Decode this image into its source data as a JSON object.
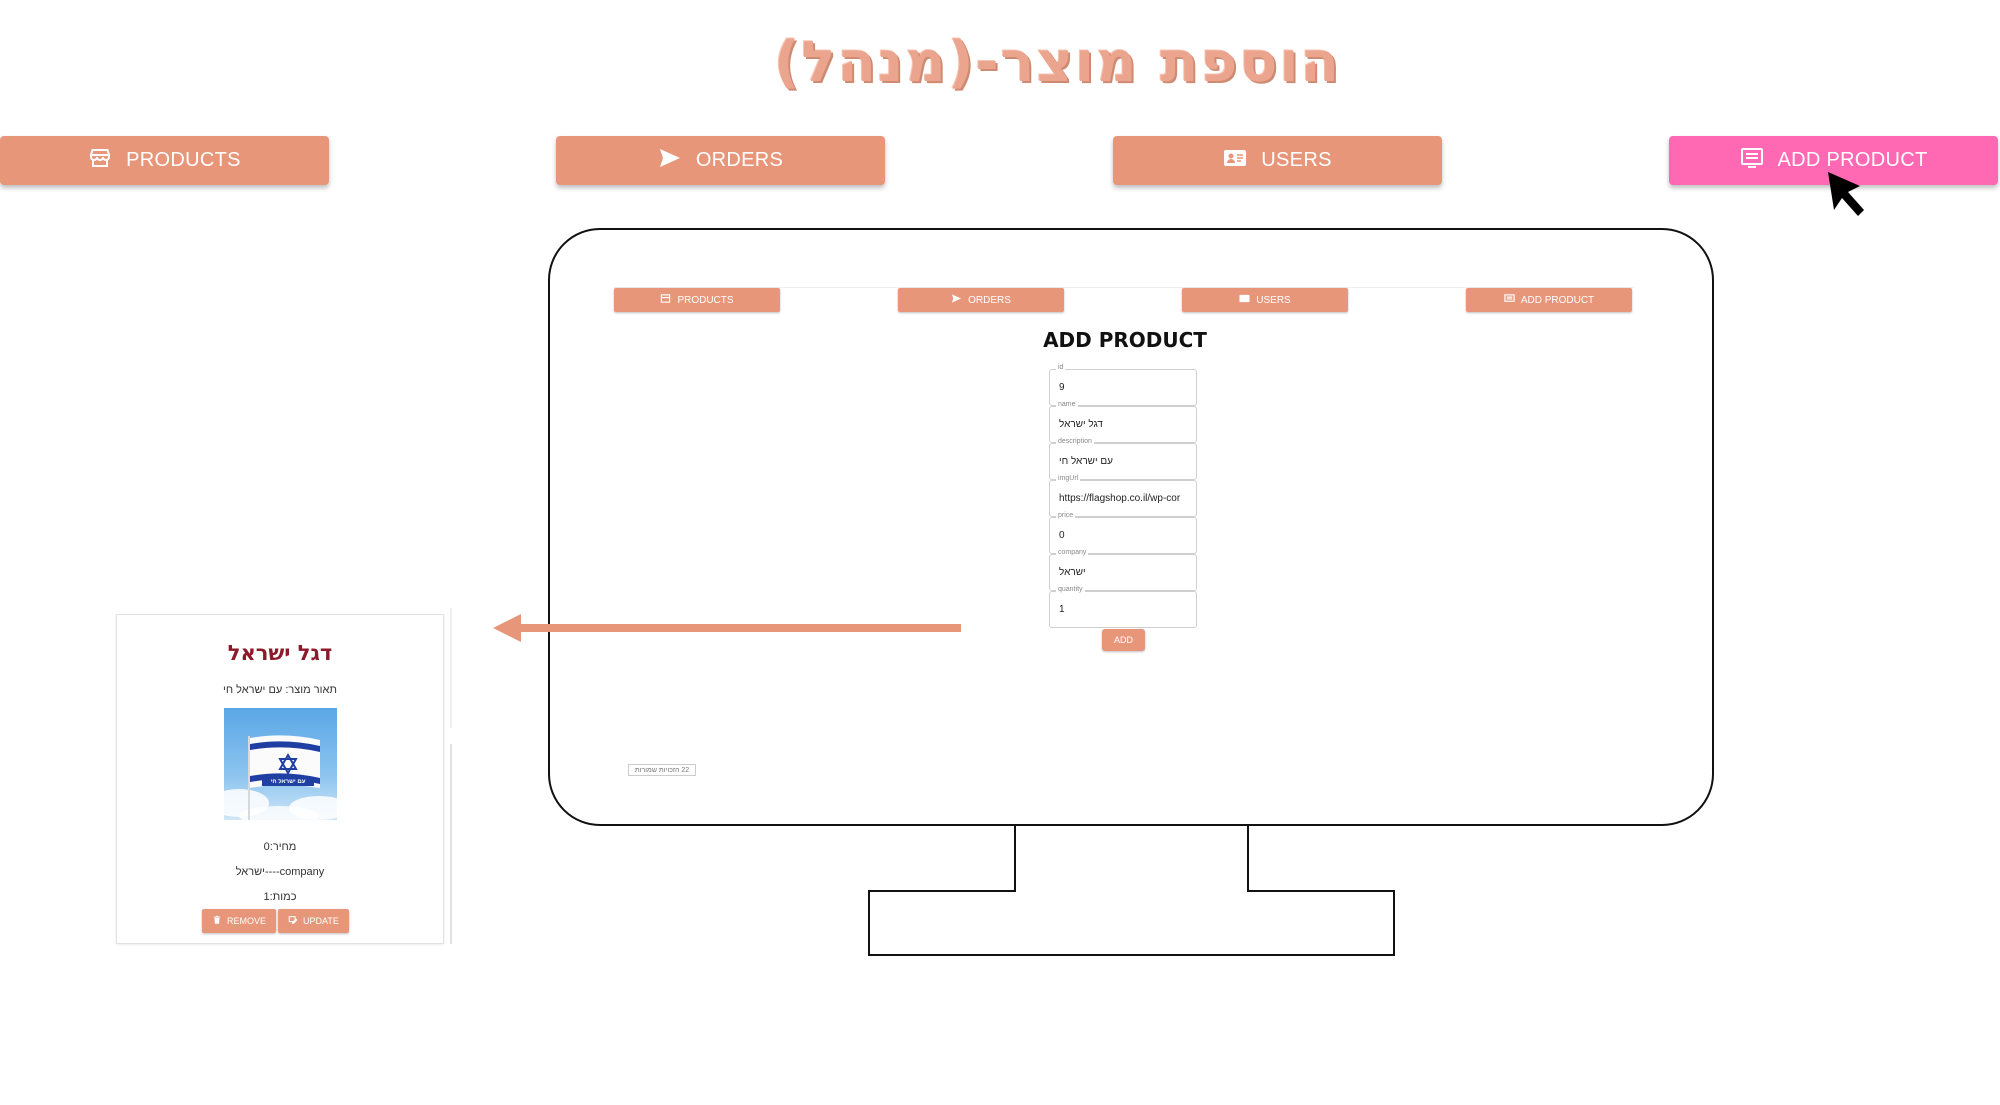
{
  "page_title": "הוספת מוצר-(מנהל)",
  "nav": {
    "products": "PRODUCTS",
    "orders": "ORDERS",
    "users": "USERS",
    "add_product": "ADD PRODUCT"
  },
  "colors": {
    "accent": "#e8967a",
    "active": "#ff69b4",
    "title": "#eba48d",
    "card_name": "#8b1a2a"
  },
  "screen": {
    "nav": {
      "products": "PRODUCTS",
      "orders": "ORDERS",
      "users": "USERS",
      "add_product": "ADD PRODUCT"
    },
    "form": {
      "title": "ADD PRODUCT",
      "fields": [
        {
          "label": "id",
          "value": "9"
        },
        {
          "label": "name",
          "value": "דגל ישראל"
        },
        {
          "label": "description",
          "value": "עם ישראל חי"
        },
        {
          "label": "imgUrl",
          "value": "https://flagshop.co.il/wp-cor"
        },
        {
          "label": "price",
          "value": "0"
        },
        {
          "label": "company",
          "value": "ישראל"
        },
        {
          "label": "quantity",
          "value": "1"
        }
      ],
      "submit": "ADD"
    },
    "footer": "22 הזכויות שמורות"
  },
  "card": {
    "name": "דגל ישראל",
    "description": "תאור מוצר: עם ישראל חי",
    "image_caption": "עם ישראל חי",
    "price": "מחיר:0",
    "company": "company----ישראל",
    "quantity": "כמות:1",
    "remove": "REMOVE",
    "update": "UPDATE"
  }
}
